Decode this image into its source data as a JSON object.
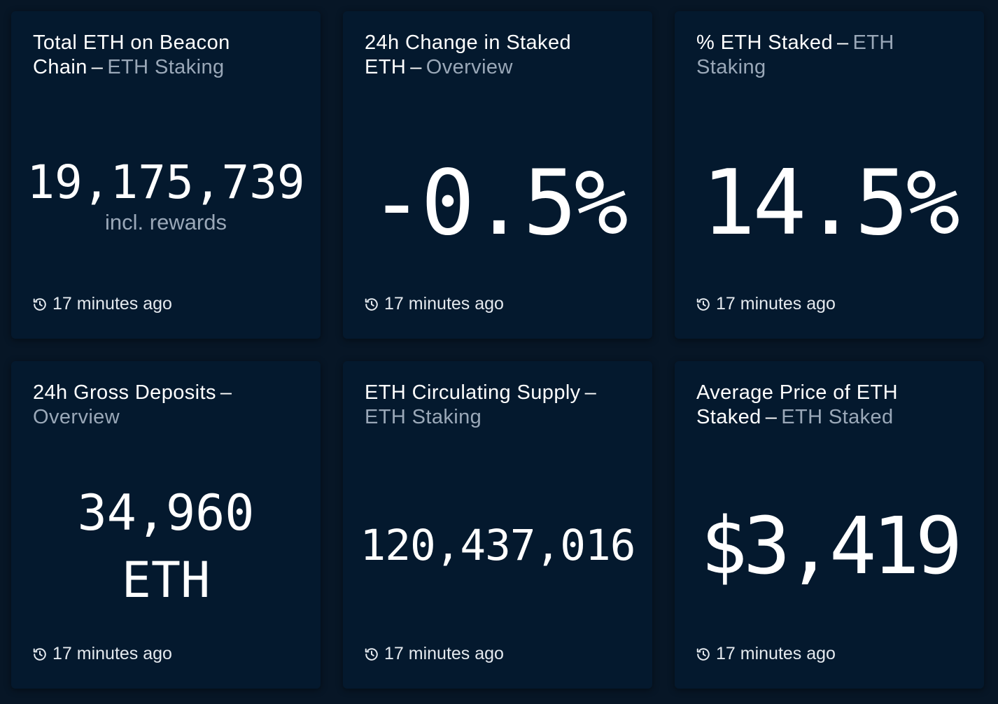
{
  "footer_text": "17 minutes ago",
  "cards": [
    {
      "title": "Total ETH on Beacon Chain",
      "subtitle": "ETH Staking",
      "value": "19,175,739",
      "value_sub": "incl. rewards"
    },
    {
      "title": "24h Change in Staked ETH",
      "subtitle": "Overview",
      "value": "-0.5%"
    },
    {
      "title": "% ETH Staked",
      "subtitle": "ETH Staking",
      "value": "14.5%"
    },
    {
      "title": "24h Gross Deposits",
      "subtitle": "Overview",
      "value_line1": "34,960",
      "value_line2": "ETH"
    },
    {
      "title": "ETH Circulating Supply",
      "subtitle": "ETH Staking",
      "value": "120,437,016"
    },
    {
      "title": "Average Price of ETH Staked",
      "subtitle": "ETH Staked",
      "value": "$3,419"
    }
  ],
  "icons": {
    "timestamp": "history-icon"
  },
  "colors": {
    "background": "#071626",
    "card": "#04192e",
    "text": "#ffffff",
    "muted": "#9aa8b8"
  }
}
